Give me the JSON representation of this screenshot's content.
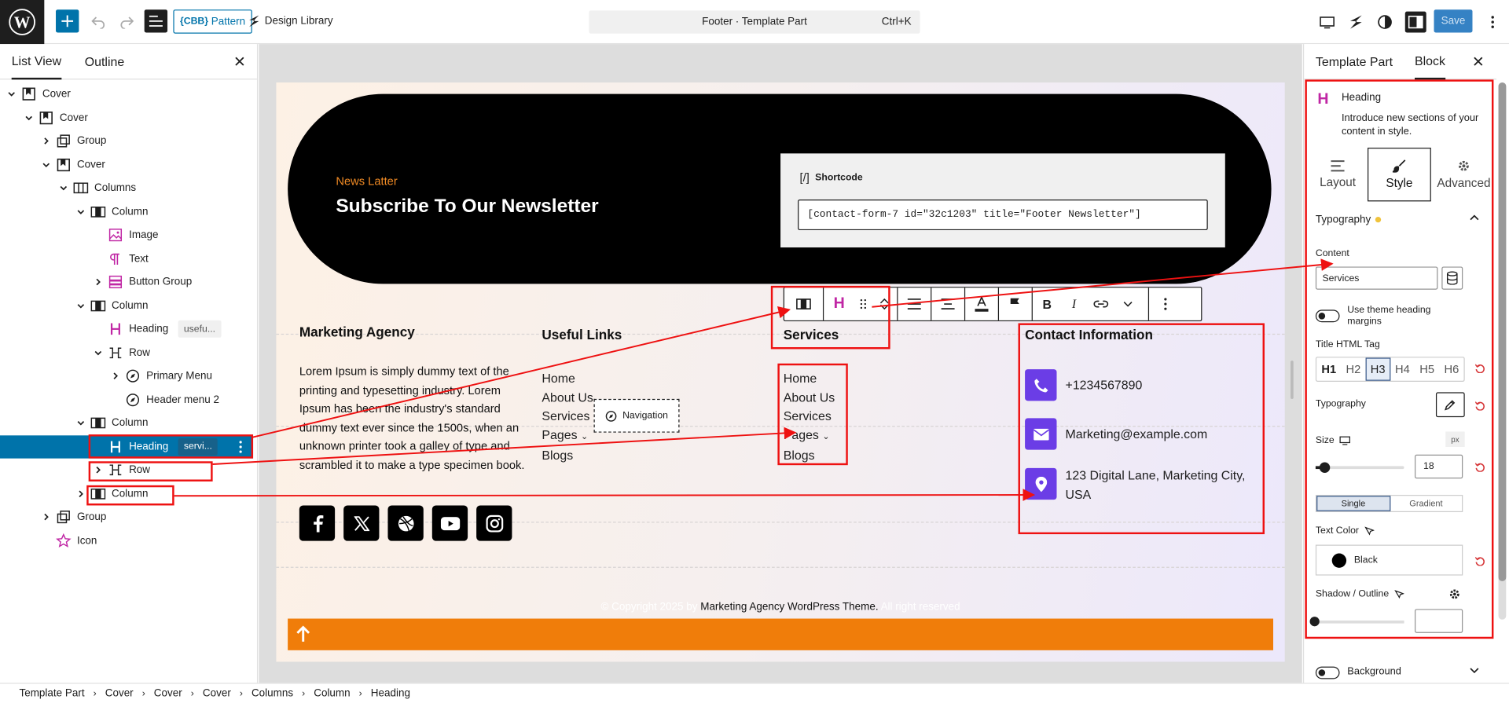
{
  "topbar": {
    "pattern_label": "Pattern",
    "pattern_prefix": "{CBB}",
    "design_library_label": "Design Library",
    "document_title": "Footer · Template Part",
    "shortcut": "Ctrl+K",
    "save_label": "Save"
  },
  "left_panel": {
    "tabs": [
      "List View",
      "Outline"
    ],
    "tree": [
      {
        "label": "Cover",
        "icon": "cover-icon",
        "depth": 0,
        "expanded": true
      },
      {
        "label": "Cover",
        "icon": "cover-icon",
        "depth": 1,
        "expanded": true
      },
      {
        "label": "Group",
        "icon": "group-icon",
        "depth": 2,
        "expanded": false
      },
      {
        "label": "Cover",
        "icon": "cover-icon",
        "depth": 2,
        "expanded": true
      },
      {
        "label": "Columns",
        "icon": "columns-icon",
        "depth": 3,
        "expanded": true
      },
      {
        "label": "Column",
        "icon": "column-icon",
        "depth": 4,
        "expanded": true
      },
      {
        "label": "Image",
        "icon": "image-icon",
        "depth": 5
      },
      {
        "label": "Text",
        "icon": "paragraph-icon",
        "depth": 5
      },
      {
        "label": "Button Group",
        "icon": "button-group-icon",
        "depth": 5,
        "expanded": false
      },
      {
        "label": "Column",
        "icon": "column-icon",
        "depth": 4,
        "expanded": true
      },
      {
        "label": "Heading",
        "icon": "heading-icon",
        "depth": 5,
        "badge": "usefu..."
      },
      {
        "label": "Row",
        "icon": "row-icon",
        "depth": 5,
        "expanded": true
      },
      {
        "label": "Primary Menu",
        "icon": "navigation-icon",
        "depth": 6,
        "expanded": false
      },
      {
        "label": "Header menu 2",
        "icon": "navigation-icon",
        "depth": 6
      },
      {
        "label": "Column",
        "icon": "column-icon",
        "depth": 4,
        "expanded": true
      },
      {
        "label": "Heading",
        "icon": "heading-icon",
        "depth": 5,
        "badge": "servi...",
        "selected": true
      },
      {
        "label": "Row",
        "icon": "row-icon",
        "depth": 5,
        "expanded": false
      },
      {
        "label": "Column",
        "icon": "column-icon",
        "depth": 4,
        "expanded": false
      },
      {
        "label": "Group",
        "icon": "group-icon",
        "depth": 2,
        "expanded": false
      },
      {
        "label": "Icon",
        "icon": "star-icon",
        "depth": 2
      }
    ]
  },
  "canvas": {
    "news_kicker": "News Latter",
    "news_title": "Subscribe To Our Newsletter",
    "shortcode_label": "Shortcode",
    "shortcode_value": "[contact-form-7 id=\"32c1203\" title=\"Footer Newsletter\"]",
    "agency_heading": "Marketing Agency",
    "agency_text": "Lorem Ipsum is simply dummy text of the printing and typesetting industry. Lorem Ipsum has been the industry's standard dummy text ever since the 1500s, when an unknown printer took a galley of type and scrambled it to make a type specimen book.",
    "useful_heading": "Useful Links",
    "useful_links": [
      "Home",
      "About Us",
      "Services",
      "Pages",
      "Blogs"
    ],
    "navigation_chip": "Navigation",
    "services_heading": "Services",
    "services_links": [
      "Home",
      "About Us",
      "Services",
      "Pages",
      "Blogs"
    ],
    "contact_heading": "Contact Information",
    "contact_phone": "+1234567890",
    "contact_email": "Marketing@example.com",
    "contact_address": "123 Digital Lane, Marketing City, USA",
    "social_icons": [
      "facebook-icon",
      "x-icon",
      "dribbble-icon",
      "youtube-icon",
      "instagram-icon"
    ],
    "copyright_pre": "© Copyright 2025 by ",
    "copyright_link": "Marketing Agency WordPress Theme.",
    "copyright_post": " All right reserved"
  },
  "right_panel": {
    "tabs": [
      "Template Part",
      "Block"
    ],
    "block_name": "Heading",
    "block_desc": "Introduce new sections of your content in style.",
    "subtabs": [
      "Layout",
      "Style",
      "Advanced"
    ],
    "active_subtab": "Style",
    "typography_header": "Typography",
    "content_label": "Content",
    "content_value": "Services",
    "theme_margins_label": "Use theme heading margins",
    "title_tag_label": "Title HTML Tag",
    "tags": [
      "H1",
      "H2",
      "H3",
      "H4",
      "H5",
      "H6"
    ],
    "active_tag": "H3",
    "typography_label": "Typography",
    "size_label": "Size",
    "size_unit": "px",
    "size_value": "18",
    "gradient_options": [
      "Single",
      "Gradient"
    ],
    "text_color_label": "Text Color",
    "text_color_value": "Black",
    "shadow_label": "Shadow / Outline",
    "background_label": "Background"
  },
  "breadcrumb": [
    "Template Part",
    "Cover",
    "Cover",
    "Cover",
    "Columns",
    "Column",
    "Heading"
  ],
  "colors": {
    "accent": "#0073aa",
    "annotation": "#e11111",
    "icon_purple": "#6b3de6",
    "footer_bar": "#f07d0a",
    "kicker": "#f08a24"
  }
}
